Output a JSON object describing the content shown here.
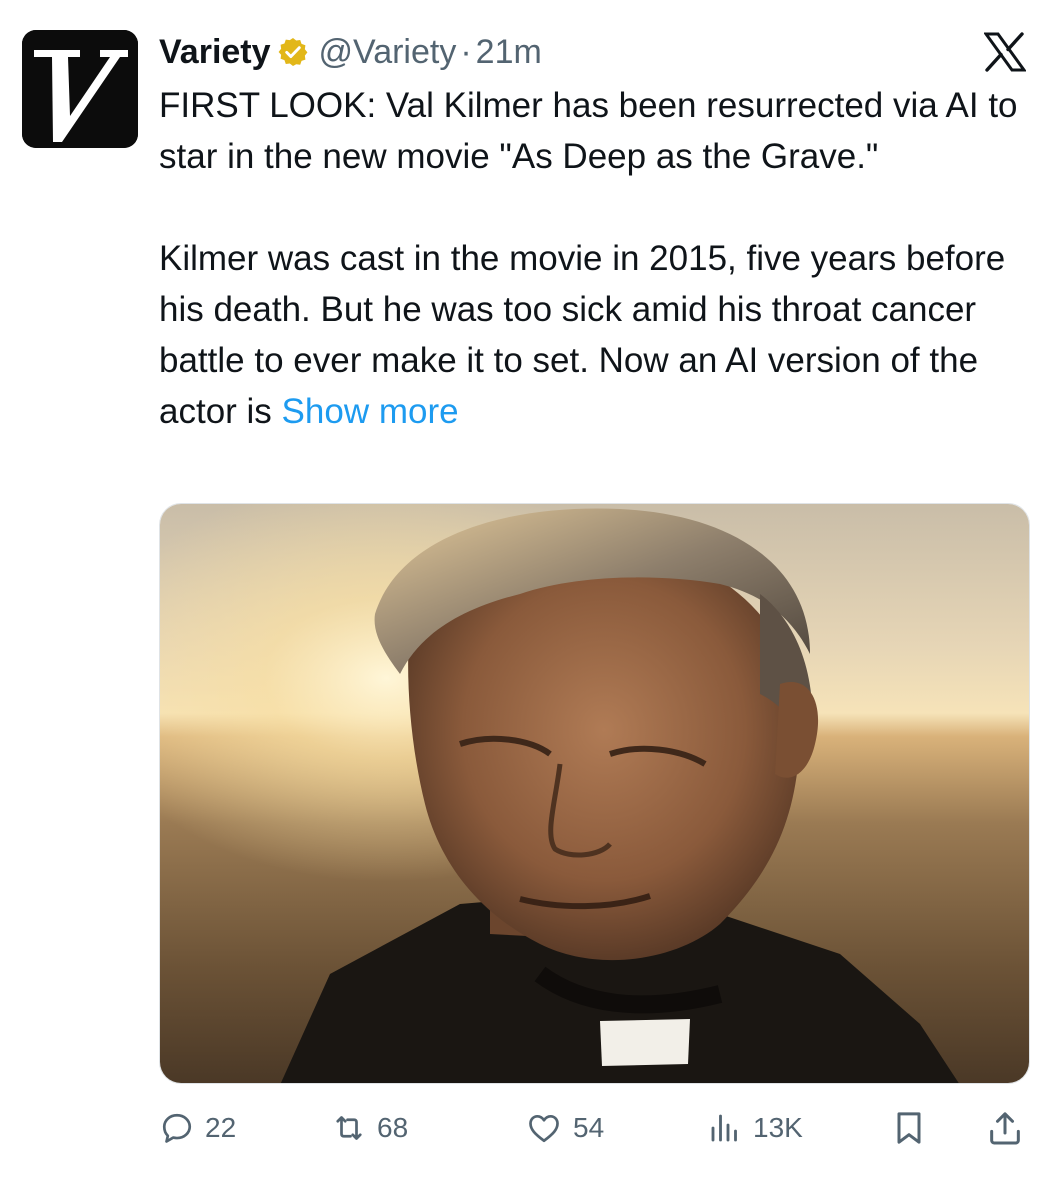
{
  "account": {
    "name": "Variety",
    "handle": "@Variety",
    "separator": "·",
    "time": "21m",
    "avatar_icon": "variety-v-logo",
    "verified_color": "#e2b719"
  },
  "platform_icon": "x-logo",
  "tweet": {
    "paragraph1": "FIRST LOOK: Val Kilmer has been resurrected via AI to star in the new movie \"As Deep as the Grave.\"",
    "paragraph2": "Kilmer was cast in the movie in 2015, five years before his death. But he was too sick amid his throat cancer battle to ever make it to set. Now an AI version of the actor is",
    "show_more": "Show more"
  },
  "media": {
    "type": "photo",
    "icon": "photo-of-man-in-clerical-collar"
  },
  "actions": {
    "replies": "22",
    "reposts": "68",
    "likes": "54",
    "views": "13K",
    "bookmark_icon": "bookmark-icon",
    "share_icon": "share-icon"
  },
  "colors": {
    "text": "#0f1419",
    "secondary": "#536471",
    "link": "#1d9bf0"
  }
}
